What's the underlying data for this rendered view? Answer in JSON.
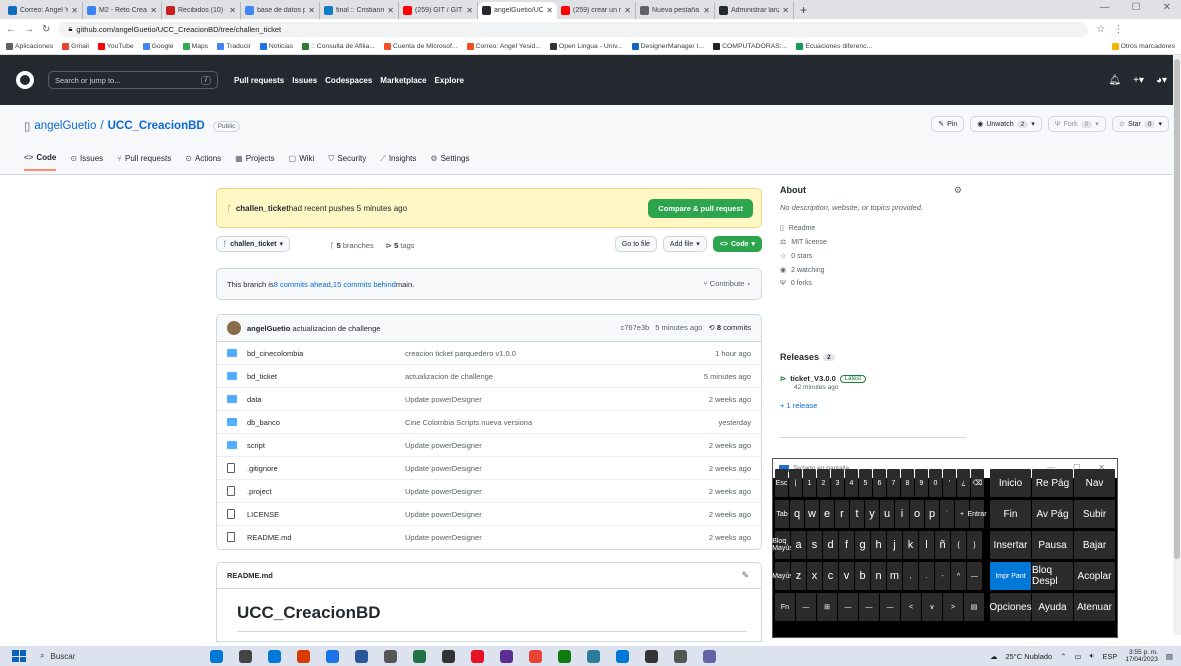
{
  "browser": {
    "tabs": [
      {
        "title": "Correo: Angel Yesi",
        "color": "#0f6cbd"
      },
      {
        "title": "M2 - Reto Creacio",
        "color": "#3b82f6"
      },
      {
        "title": "Recibidos (10) - pe",
        "color": "#c5221f"
      },
      {
        "title": "base de datos par",
        "color": "#4285f4"
      },
      {
        "title": "final :: Cristianrem",
        "color": "#0e7dc6"
      },
      {
        "title": "(259) GIT / GITHUB",
        "color": "#ff0000"
      },
      {
        "title": "angelGuetio/UCC_",
        "color": "#24292f",
        "active": true
      },
      {
        "title": "(259) crear un rele",
        "color": "#ff0000"
      },
      {
        "title": "Nueva pestaña",
        "color": "#5f6368"
      },
      {
        "title": "Administrar lanzar",
        "color": "#24292f"
      }
    ],
    "url": "github.com/angelGuetio/UCC_CreacionBD/tree/challen_ticket",
    "bookmarks": [
      {
        "label": "Aplicaciones",
        "color": "#5f6368"
      },
      {
        "label": "Gmail",
        "color": "#ea4335"
      },
      {
        "label": "YouTube",
        "color": "#ff0000"
      },
      {
        "label": "Google",
        "color": "#4285f4"
      },
      {
        "label": "Maps",
        "color": "#34a853"
      },
      {
        "label": "Traducir",
        "color": "#4285f4"
      },
      {
        "label": "Noticias",
        "color": "#1a73e8"
      },
      {
        "label": ":: Consulta de Afilia...",
        "color": "#2e7d32"
      },
      {
        "label": "Cuenta de Microsof...",
        "color": "#f25022"
      },
      {
        "label": "Correo: Angel Yesid...",
        "color": "#f25022"
      },
      {
        "label": "Open Lingua - Univ...",
        "color": "#333333"
      },
      {
        "label": "DesignerManager I...",
        "color": "#1565c0"
      },
      {
        "label": "COMPUTADORAS:...",
        "color": "#212121"
      },
      {
        "label": "Ecuaciones diferenc...",
        "color": "#0f9d58"
      }
    ],
    "other_bookmarks": "Otros marcadores"
  },
  "github": {
    "search_placeholder": "Search or jump to...",
    "search_key": "/",
    "nav": [
      "Pull requests",
      "Issues",
      "Codespaces",
      "Marketplace",
      "Explore"
    ]
  },
  "repo": {
    "owner": "angelGuetio",
    "sep": "/",
    "name": "UCC_CreacionBD",
    "visibility": "Public",
    "pin": "Pin",
    "watch": "Unwatch",
    "watch_count": "2",
    "fork": "Fork",
    "fork_count": "0",
    "star": "Star",
    "star_count": "0",
    "tabs": [
      "Code",
      "Issues",
      "Pull requests",
      "Actions",
      "Projects",
      "Wiki",
      "Security",
      "Insights",
      "Settings"
    ]
  },
  "alert": {
    "branch": "challen_ticket",
    "text": " had recent pushes 5 minutes ago",
    "button": "Compare & pull request"
  },
  "branch": {
    "current": "challen_ticket",
    "branches_count": "5",
    "branches_label": "branches",
    "tags_count": "5",
    "tags_label": "tags",
    "go_to_file": "Go to file",
    "add_file": "Add file",
    "code": "Code"
  },
  "ahead": {
    "prefix": "This branch is ",
    "ahead_link": "8 commits ahead",
    "sep": ", ",
    "behind_link": "15 commits behind",
    "suffix": " main.",
    "contribute": "Contribute"
  },
  "commit": {
    "author": "angelGuetio",
    "message": "actualizacion de challenge",
    "hash": "c767e3b",
    "when": "5 minutes ago",
    "count": "8",
    "count_label": "commits"
  },
  "files": [
    {
      "type": "folder",
      "name": "bd_cinecolombia",
      "message": "creacion ticket parquedero v1.0.0",
      "age": "1 hour ago"
    },
    {
      "type": "folder",
      "name": "bd_ticket",
      "message": "actualizacion de challenge",
      "age": "5 minutes ago"
    },
    {
      "type": "folder",
      "name": "data",
      "message": "Update powerDesigner",
      "age": "2 weeks ago"
    },
    {
      "type": "folder",
      "name": "db_banco",
      "message": "Cine Colombia Scripts nueva versiona",
      "age": "yesterday"
    },
    {
      "type": "folder",
      "name": "script",
      "message": "Update powerDesigner",
      "age": "2 weeks ago"
    },
    {
      "type": "file",
      "name": ".gitignore",
      "message": "Update powerDesigner",
      "age": "2 weeks ago"
    },
    {
      "type": "file",
      "name": ".project",
      "message": "Update powerDesigner",
      "age": "2 weeks ago"
    },
    {
      "type": "file",
      "name": "LICENSE",
      "message": "Update powerDesigner",
      "age": "2 weeks ago"
    },
    {
      "type": "file",
      "name": "README.md",
      "message": "Update powerDesigner",
      "age": "2 weeks ago"
    }
  ],
  "readme": {
    "filename": "README.md",
    "heading": "UCC_CreacionBD"
  },
  "about": {
    "title": "About",
    "description": "No description, website, or topics provided.",
    "items": [
      {
        "icon": "book-icon",
        "glyph": "▯",
        "label": "Readme"
      },
      {
        "icon": "law-icon",
        "glyph": "⚖",
        "label": "MIT license"
      },
      {
        "icon": "star-icon",
        "glyph": "☆",
        "label": "0 stars"
      },
      {
        "icon": "eye-icon",
        "glyph": "◉",
        "label": "2 watching"
      },
      {
        "icon": "fork-icon",
        "glyph": "Ψ",
        "label": "0 forks"
      }
    ]
  },
  "releases": {
    "title": "Releases",
    "count": "2",
    "tag": "ticket_V3.0.0",
    "badge": "Latest",
    "when": "42 minutes ago",
    "more": "+ 1 release"
  },
  "osk": {
    "title": "Teclado en pantalla",
    "row1": [
      "Esc",
      "|",
      "1",
      "2",
      "3",
      "4",
      "5",
      "6",
      "7",
      "8",
      "9",
      "0",
      "'",
      "¿",
      "⌫"
    ],
    "row2": [
      "Tab",
      "q",
      "w",
      "e",
      "r",
      "t",
      "y",
      "u",
      "i",
      "o",
      "p",
      "´",
      "+",
      "Entrar"
    ],
    "row3": [
      "Bloq Mayús",
      "a",
      "s",
      "d",
      "f",
      "g",
      "h",
      "j",
      "k",
      "l",
      "ñ",
      "{",
      "}"
    ],
    "row4": [
      "Mayús",
      "z",
      "x",
      "c",
      "v",
      "b",
      "n",
      "m",
      ",",
      ".",
      "-",
      "^",
      "—"
    ],
    "row5": [
      "Fn",
      "—",
      "⊞",
      "—",
      "—",
      "—",
      "<",
      "∨",
      ">",
      "▤"
    ],
    "side": [
      [
        "Inicio",
        "Re Pág",
        "Nav"
      ],
      [
        "Fin",
        "Av Pág",
        "Subir"
      ],
      [
        "Insertar",
        "Pausa",
        "Bajar"
      ],
      [
        "Impr Pant",
        "Bloq Despl",
        "Acoplar"
      ],
      [
        "Opciones",
        "Ayuda",
        "Atenuar"
      ]
    ]
  },
  "taskbar": {
    "search": "Buscar",
    "apps": [
      "#0078d7",
      "#444444",
      "#0078d7",
      "#d83b01",
      "#1a73e8",
      "#2b579a",
      "#555555",
      "#217346",
      "#333333",
      "#e81123",
      "#5c2d91",
      "#ea4335",
      "#0f7b0f",
      "#2d7d9a",
      "#0078d7",
      "#333333",
      "#555555",
      "#6264a7"
    ],
    "weather": "25°C Nublado",
    "lang": "ESP",
    "time": "3:55 p. m.",
    "date": "17/04/2023"
  }
}
